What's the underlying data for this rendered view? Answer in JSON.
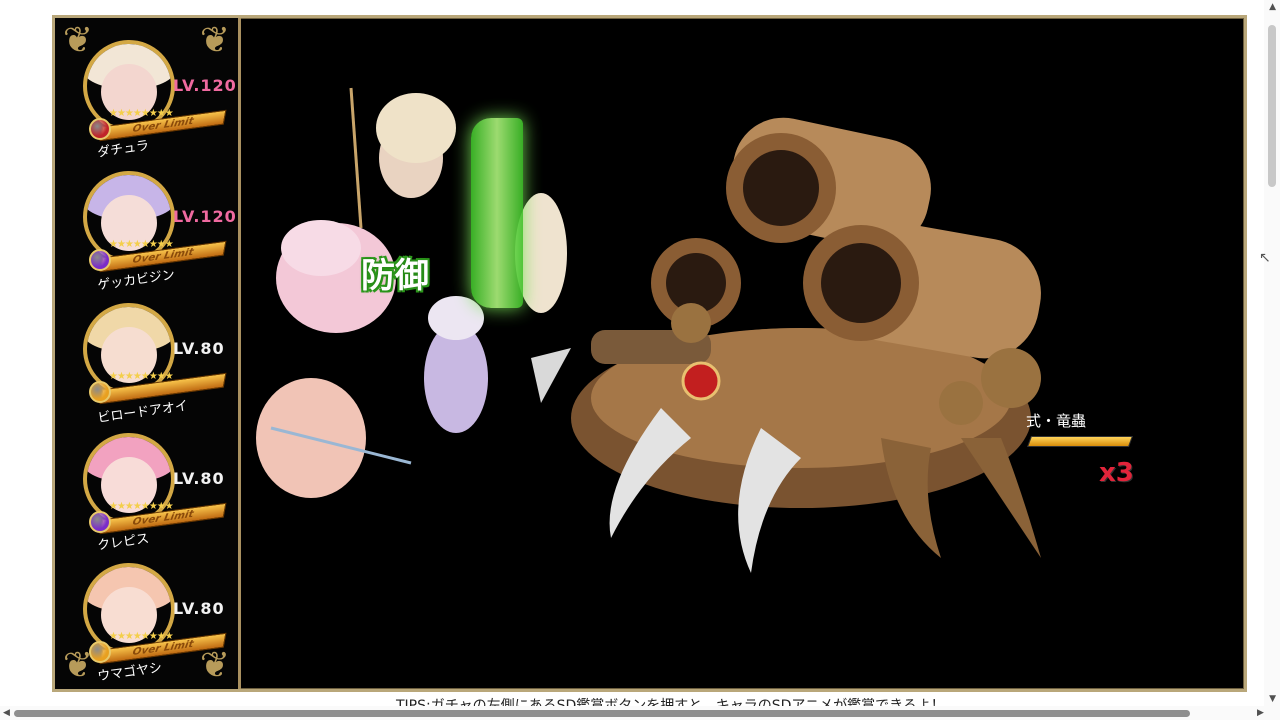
{
  "sidebar": {
    "characters": [
      {
        "name": "ダチュラ",
        "level": "LV.120",
        "limit_label": "Over Limit",
        "stars": "★★★★★★★★",
        "orb_color": "#c0242a",
        "hair_color": "#f2e6d6",
        "face_color": "#f3d6cf",
        "level_style": "pink"
      },
      {
        "name": "ゲッカビジン",
        "level": "LV.120",
        "limit_label": "Over Limit",
        "stars": "★★★★★★★★",
        "orb_color": "#7a2cc9",
        "hair_color": "#c7b5e8",
        "face_color": "#f5ddd8",
        "level_style": "pink"
      },
      {
        "name": "ビロードアオイ",
        "level": "LV.80",
        "limit_label": "",
        "stars": "★★★★★★★★",
        "orb_color": "#e8a020",
        "hair_color": "#f0d8a8",
        "face_color": "#f6ddd0",
        "level_style": "white"
      },
      {
        "name": "クレピス",
        "level": "LV.80",
        "limit_label": "Over Limit",
        "stars": "★★★★★★★★",
        "orb_color": "#7a2cc9",
        "hair_color": "#f2a2c0",
        "face_color": "#f8dcd8",
        "level_style": "white"
      },
      {
        "name": "ウマゴヤシ",
        "level": "LV.80",
        "limit_label": "Over Limit",
        "stars": "★★★★★★★★",
        "orb_color": "#e8a020",
        "hair_color": "#f5c6b0",
        "face_color": "#f8ddd2",
        "level_style": "white"
      }
    ]
  },
  "battle": {
    "effect_label": "防御",
    "boss_name": "式・竜蟲",
    "boss_multiplier": "x3"
  },
  "footer": {
    "tips": "TIPS:ガチャの左側にあるSD鑑賞ボタンを押すと、キャラのSDアニメが鑑賞できるよ！"
  },
  "colors": {
    "frame_border": "#b9a77a",
    "boss_body": "#8a6238",
    "shield_green": "#6fe04a"
  }
}
